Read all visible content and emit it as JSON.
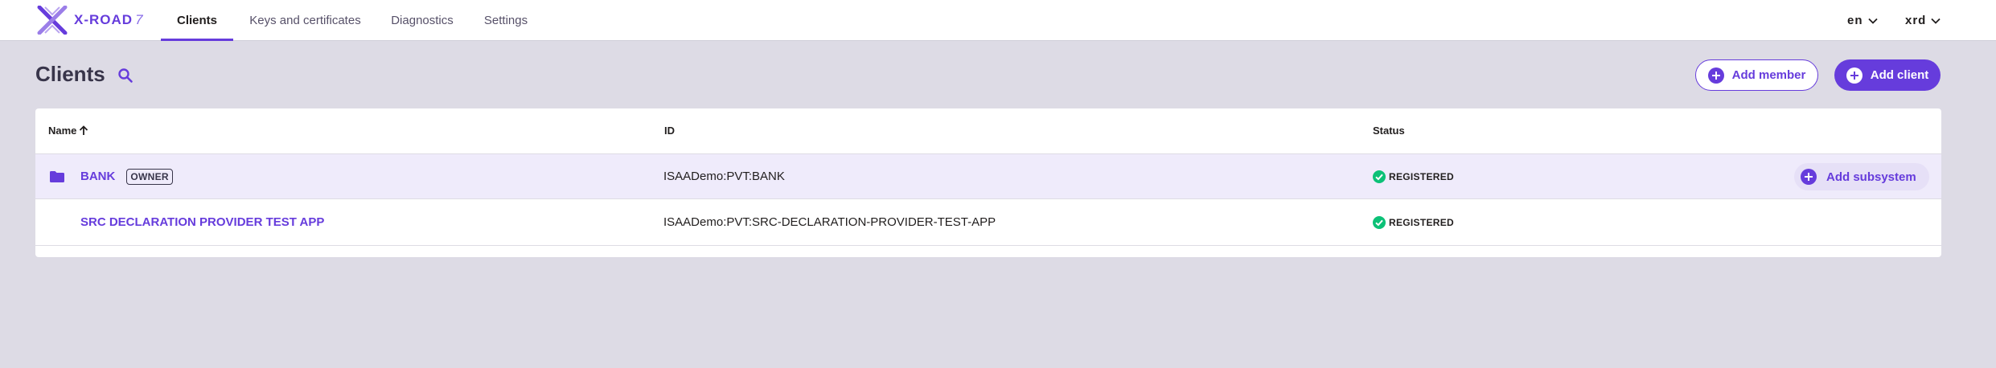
{
  "brand": {
    "name": "X-ROAD",
    "version": "7"
  },
  "nav": {
    "tabs": [
      {
        "label": "Clients",
        "active": true
      },
      {
        "label": "Keys and certificates",
        "active": false
      },
      {
        "label": "Diagnostics",
        "active": false
      },
      {
        "label": "Settings",
        "active": false
      }
    ],
    "language": "en",
    "user": "xrd"
  },
  "page": {
    "title": "Clients",
    "add_member_label": "Add member",
    "add_client_label": "Add client"
  },
  "table": {
    "columns": {
      "name": "Name",
      "id": "ID",
      "status": "Status"
    },
    "sort": "name-ascending",
    "rows": [
      {
        "name": "BANK",
        "badge": "OWNER",
        "id": "ISAADemo:PVT:BANK",
        "status": "REGISTERED",
        "action": "Add subsystem",
        "icon": "folder-icon"
      },
      {
        "name": "SRC DECLARATION PROVIDER TEST APP",
        "id": "ISAADemo:PVT:SRC-DECLARATION-PROVIDER-TEST-APP",
        "status": "REGISTERED"
      }
    ]
  },
  "colors": {
    "accent": "#663cdc",
    "background": "#dddbe5",
    "status_ok": "#0cc177",
    "highlight_row": "#efebfb"
  }
}
